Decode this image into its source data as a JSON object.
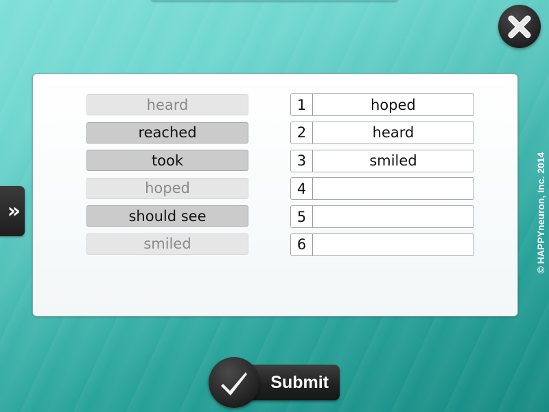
{
  "word_bank": [
    {
      "label": "heard",
      "state": "used"
    },
    {
      "label": "reached",
      "state": "active"
    },
    {
      "label": "took",
      "state": "active"
    },
    {
      "label": "hoped",
      "state": "used"
    },
    {
      "label": "should see",
      "state": "active"
    },
    {
      "label": "smiled",
      "state": "used"
    }
  ],
  "answer_slots": [
    {
      "number": "1",
      "value": "hoped"
    },
    {
      "number": "2",
      "value": "heard"
    },
    {
      "number": "3",
      "value": "smiled"
    },
    {
      "number": "4",
      "value": ""
    },
    {
      "number": "5",
      "value": ""
    },
    {
      "number": "6",
      "value": ""
    }
  ],
  "buttons": {
    "submit_label": "Submit",
    "side_toggle_glyph": "»"
  },
  "icons": {
    "close": "close-icon",
    "submit": "checkmark-icon",
    "side": "double-chevron-right-icon"
  },
  "footer": {
    "copyright": "© HAPPYneuron,  Inc. 2014"
  },
  "colors": {
    "background_accent": "#2aa49c",
    "word_active_bg": "#cbcbcb",
    "word_used_bg": "#e6e6e6",
    "button_dark": "#222222"
  }
}
